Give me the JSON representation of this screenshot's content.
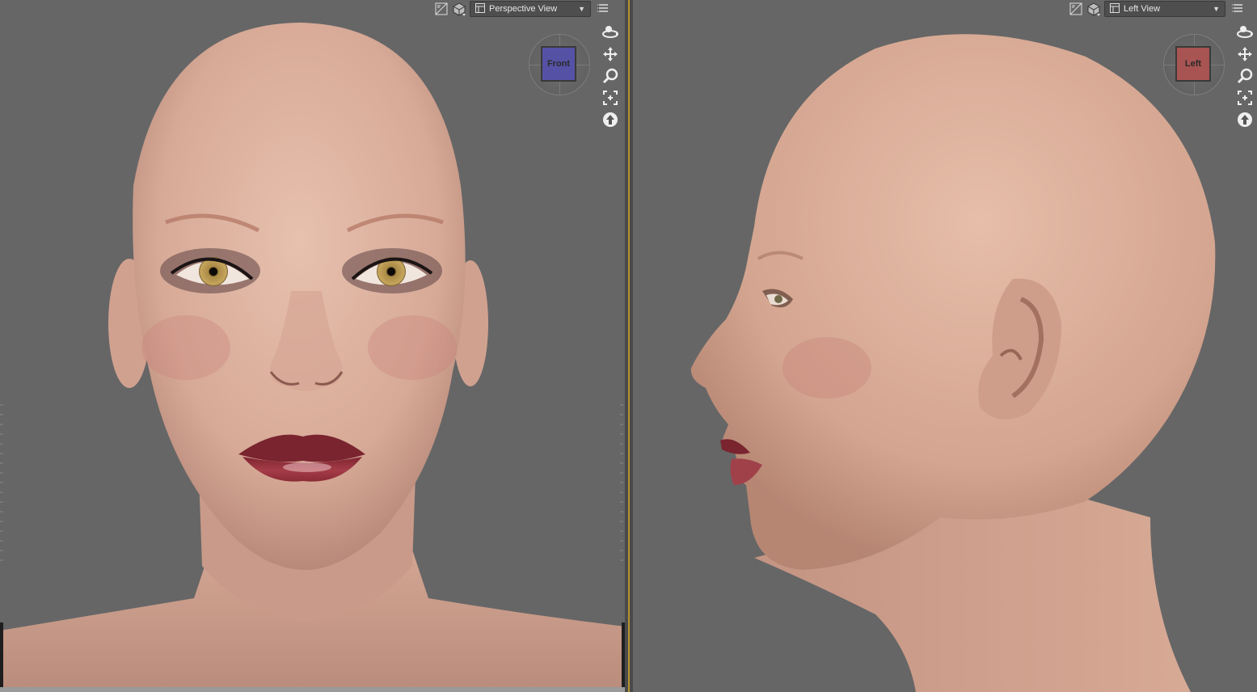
{
  "left_viewport": {
    "view_label": "Perspective View",
    "cube_face_label": "Front",
    "cube_face_color": "#5552a6"
  },
  "right_viewport": {
    "view_label": "Left View",
    "cube_face_label": "Left",
    "cube_face_color": "#a85452"
  },
  "colors": {
    "viewport_bg": "#666666",
    "divider_accent": "#b8932e",
    "toolbar_select_bg": "#4e4e4e",
    "skin": "#dcaf9c",
    "lips": "#9a2f3a",
    "iris": "#b89650"
  },
  "icons": [
    "render-toggle-icon",
    "camera-cube-icon",
    "view-grid-icon",
    "dropdown-arrow-icon",
    "menu-icon",
    "orbit-icon",
    "pan-icon",
    "zoom-icon",
    "frame-icon",
    "reset-view-icon"
  ]
}
